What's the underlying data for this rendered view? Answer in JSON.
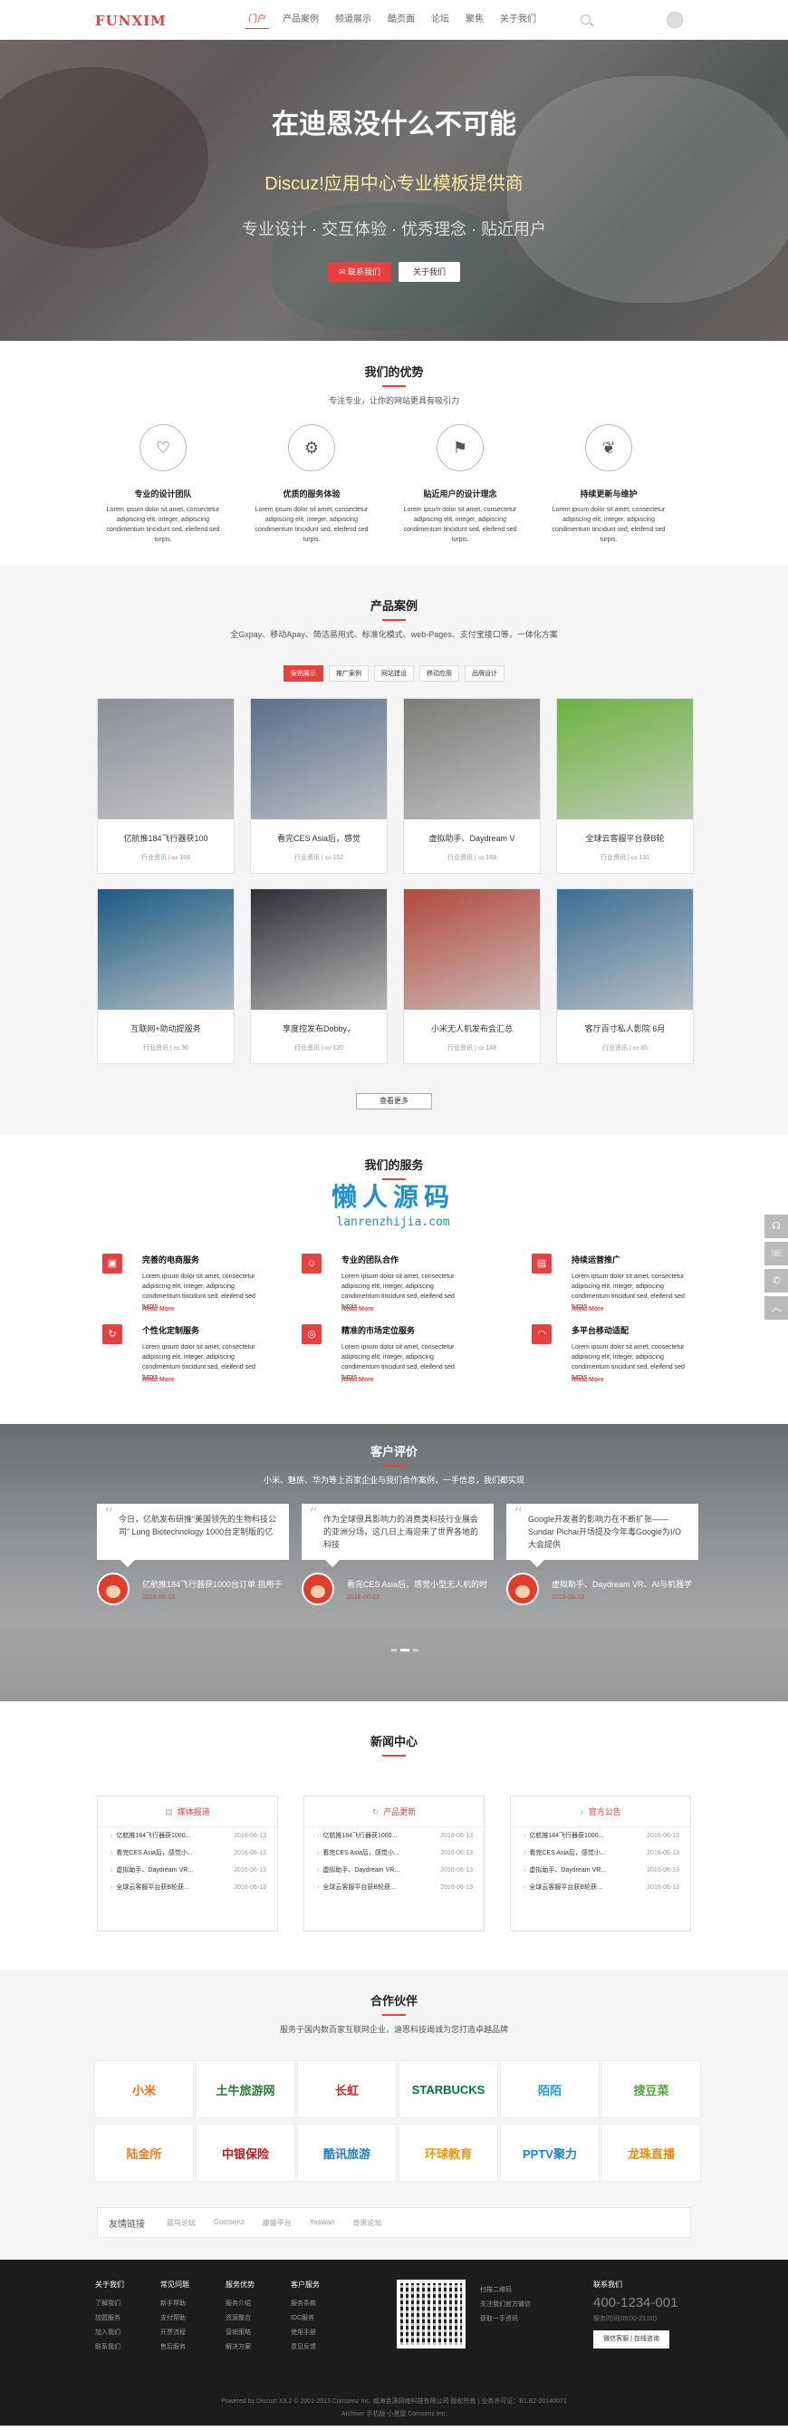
{
  "header": {
    "logo": "FUNXIM",
    "nav": [
      "门户",
      "产品案例",
      "频道展示",
      "酷页面",
      "论坛",
      "聚焦",
      "关于我们"
    ],
    "active_index": 0
  },
  "banner": {
    "title": "在迪恩没什么不可能",
    "subtitle": "Discuz!应用中心专业模板提供商",
    "tagline": "专业设计 · 交互体验 · 优秀理念 · 贴近用户",
    "primary_button": "联系我们",
    "secondary_button": "关于我们"
  },
  "features": {
    "title": "我们的优势",
    "subtitle": "专注专业，让你的网站更具有吸引力",
    "items": [
      {
        "icon": "heart-icon",
        "title": "专业的设计团队",
        "desc": "Lorem ipsum dolor sit amet, consectetur adipiscing elit, integer, adipiscing condimentum tincidunt sed, eleifend sed turpis."
      },
      {
        "icon": "gear-icon",
        "title": "优质的服务体验",
        "desc": "Lorem ipsum dolor sit amet, consectetur adipiscing elit, integer, adipiscing condimentum tincidunt sed, eleifend sed turpis."
      },
      {
        "icon": "flag-icon",
        "title": "贴近用户的设计理念",
        "desc": "Lorem ipsum dolor sit amet, consectetur adipiscing elit, integer, adipiscing condimentum tincidunt sed, eleifend sed turpis."
      },
      {
        "icon": "leaf-icon",
        "title": "持续更新与维护",
        "desc": "Lorem ipsum dolor sit amet, consectetur adipiscing elit, integer, adipiscing condimentum tincidunt sed, eleifend sed turpis."
      }
    ]
  },
  "products": {
    "title": "产品案例",
    "subtitle": "全Gxpay、移动Apay、简洁易用式、标准化模式、web-Pages、支付宝接口等，一体化方案",
    "tabs": [
      "案例展示",
      "推广案例",
      "网站建设",
      "移动应用",
      "品牌设计"
    ],
    "cards": [
      {
        "title": "亿航推184飞行器获100",
        "meta_left": "行业资讯",
        "count": "166",
        "color": "#8a8e96"
      },
      {
        "title": "看完CES Asia后，感觉",
        "meta_left": "行业资讯",
        "count": "152",
        "color": "#5a6f8c"
      },
      {
        "title": "虚拟助手、Daydream V",
        "meta_left": "行业资讯",
        "count": "168",
        "color": "#7d7b78"
      },
      {
        "title": "全球云客服平台获B轮",
        "meta_left": "行业资讯",
        "count": "131",
        "color": "#6cb33f"
      },
      {
        "title": "互联网+助动提服务",
        "meta_left": "行业资讯",
        "count": "96",
        "color": "#1d5b83"
      },
      {
        "title": "享度控发布Dobby，",
        "meta_left": "行业资讯",
        "count": "120",
        "color": "#2f3136"
      },
      {
        "title": "小米无人机发布会汇总",
        "meta_left": "行业资讯",
        "count": "148",
        "color": "#b24a3c"
      },
      {
        "title": "客厅百寸私人影院 6月",
        "meta_left": "行业资讯",
        "count": "85",
        "color": "#3d6f94"
      }
    ],
    "more": "查看更多"
  },
  "services": {
    "title": "我们的服务",
    "watermark_cn": "懒人源码",
    "watermark_en": "lanrenzhijia.com",
    "items": [
      {
        "icon": "shop-icon",
        "title": "完善的电商服务",
        "desc": "Lorem ipsum dolor sit amet, consectetur adipiscing elit, integer, adipiscing condimentum tincidunt sed, eleifend sed turpis.",
        "more": "Read More"
      },
      {
        "icon": "user-icon",
        "title": "专业的团队合作",
        "desc": "Lorem ipsum dolor sit amet, consectetur adipiscing elit, integer, adipiscing condimentum tincidunt sed, eleifend sed turpis.",
        "more": "Read More"
      },
      {
        "icon": "chart-icon",
        "title": "持续运营推广",
        "desc": "Lorem ipsum dolor sit amet, consectetur adipiscing elit, integer, adipiscing condimentum tincidunt sed, eleifend sed turpis.",
        "more": "Read More"
      },
      {
        "icon": "refresh-icon",
        "title": "个性化定制服务",
        "desc": "Lorem ipsum dolor sit amet, consectetur adipiscing elit, integer, adipiscing condimentum tincidunt sed, eleifend sed turpis.",
        "more": "Read More"
      },
      {
        "icon": "target-icon",
        "title": "精准的市场定位服务",
        "desc": "Lorem ipsum dolor sit amet, consectetur adipiscing elit, integer, adipiscing condimentum tincidunt sed, eleifend sed turpis.",
        "more": "Read More"
      },
      {
        "icon": "wifi-icon",
        "title": "多平台移动适配",
        "desc": "Lorem ipsum dolor sit amet, consectetur adipiscing elit, integer, adipiscing condimentum tincidunt sed, eleifend sed turpis.",
        "more": "Read More"
      }
    ]
  },
  "side_tools": [
    "headset-icon",
    "phone-icon",
    "wechat-icon",
    "top-icon"
  ],
  "testimonials": {
    "title": "客户评价",
    "subtitle": "小米、魅族、华为等上百家企业与我们合作案例，一手信息，我们都实现",
    "items": [
      {
        "quote": "今日，亿航发布研推“美国领先的生物科技公司” Lung Biotechnology 1000台定制版的亿",
        "name": "亿航推184飞行器获1000台订单 指用于",
        "date": "2016-06-13"
      },
      {
        "quote": "作为全球很具影响力的消费类科技行业展会的亚洲分场，这几日上海迎来了世界各地的科技",
        "name": "看完CES Asia后，感觉小型无人机的时",
        "date": "2016-06-13"
      },
      {
        "quote": "Google开发者的影响力在不断扩张——Sundar Pichai开场提及今年毒Google为I/O大会提供",
        "name": "虚拟助手、Daydream VR、AI与机器学",
        "date": "2016-06-13"
      }
    ]
  },
  "news": {
    "title": "新闻中心",
    "boxes": [
      {
        "icon": "doc-icon",
        "title": "媒体报道",
        "rows": [
          [
            "亿航推184飞行器获1000...",
            "2016-06-13"
          ],
          [
            "看完CES Asia后，感觉小...",
            "2016-06-13"
          ],
          [
            "虚拟助手、Daydream VR...",
            "2016-06-13"
          ],
          [
            "全球云客服平台获B轮获...",
            "2016-06-13"
          ]
        ]
      },
      {
        "icon": "refresh-icon",
        "title": "产品更新",
        "rows": [
          [
            "亿航推184飞行器获1000...",
            "2016-06-13"
          ],
          [
            "看完CES Asia后，感觉小...",
            "2016-06-13"
          ],
          [
            "虚拟助手、Daydream VR...",
            "2016-06-13"
          ],
          [
            "全球云客服平台获B轮获...",
            "2016-06-13"
          ]
        ]
      },
      {
        "icon": "bell-icon",
        "title": "官方公告",
        "rows": [
          [
            "亿航推184飞行器获1000...",
            "2016-06-13"
          ],
          [
            "看完CES Asia后，感觉小...",
            "2016-06-13"
          ],
          [
            "虚拟助手、Daydream VR...",
            "2016-06-13"
          ],
          [
            "全球云客服平台获B轮获...",
            "2016-06-13"
          ]
        ]
      }
    ]
  },
  "partners": {
    "title": "合作伙伴",
    "subtitle": "服务于国内数百家互联网企业，迪恩科技竭诚为您打造卓越品牌",
    "logos": [
      {
        "text": "小米",
        "color": "#ff6700"
      },
      {
        "text": "土牛旅游网",
        "color": "#2a7a35"
      },
      {
        "text": "长虹",
        "color": "#d7252c"
      },
      {
        "text": "STARBUCKS",
        "color": "#00704a"
      },
      {
        "text": "陌陌",
        "color": "#1d9bf0"
      },
      {
        "text": "搜豆菜",
        "color": "#51a93b"
      },
      {
        "text": "陆金所",
        "color": "#ef7d1a"
      },
      {
        "text": "中银保险",
        "color": "#b81c22"
      },
      {
        "text": "酷讯旅游",
        "color": "#1e7bc7"
      },
      {
        "text": "环球教育",
        "color": "#f39800"
      },
      {
        "text": "PPTV聚力",
        "color": "#1d83d8"
      },
      {
        "text": "龙珠直播",
        "color": "#f08a00"
      }
    ],
    "links_label": "友情链接",
    "links": [
      "蓝鸟论坛",
      "Comsenz",
      "康盛平台",
      "Yeswan",
      "奇思论坛"
    ]
  },
  "footer": {
    "cols": [
      {
        "title": "关于我们",
        "items": [
          "了解我们",
          "加盟服务",
          "加入我们",
          "联系我们"
        ]
      },
      {
        "title": "常见问题",
        "items": [
          "新手帮助",
          "支付帮助",
          "开票流程",
          "售后服务"
        ]
      },
      {
        "title": "服务优势",
        "items": [
          "服务介绍",
          "资源整合",
          "营销策略",
          "解决方案"
        ]
      },
      {
        "title": "客户服务",
        "items": [
          "服务条款",
          "IDC服务",
          "使用手册",
          "意见反馈"
        ]
      }
    ],
    "qr_text": [
      "扫描二维码",
      "关注我们官方微信",
      "获取一手资讯"
    ],
    "phone_title": "联系我们",
    "phone": "400-1234-001",
    "hours": "服务时间(09:00-21:00)",
    "button": "微信客服 | 在线咨询",
    "copy1": "Powered by Discuz! X3.2 © 2001-2013 Comsenz Inc.  威海金源网络科技有限公司 版权所有  |  业务许可证：B1.B2-20140071",
    "copy2": "Archiver  手机版  小黑屋  Comsenz Inc."
  }
}
